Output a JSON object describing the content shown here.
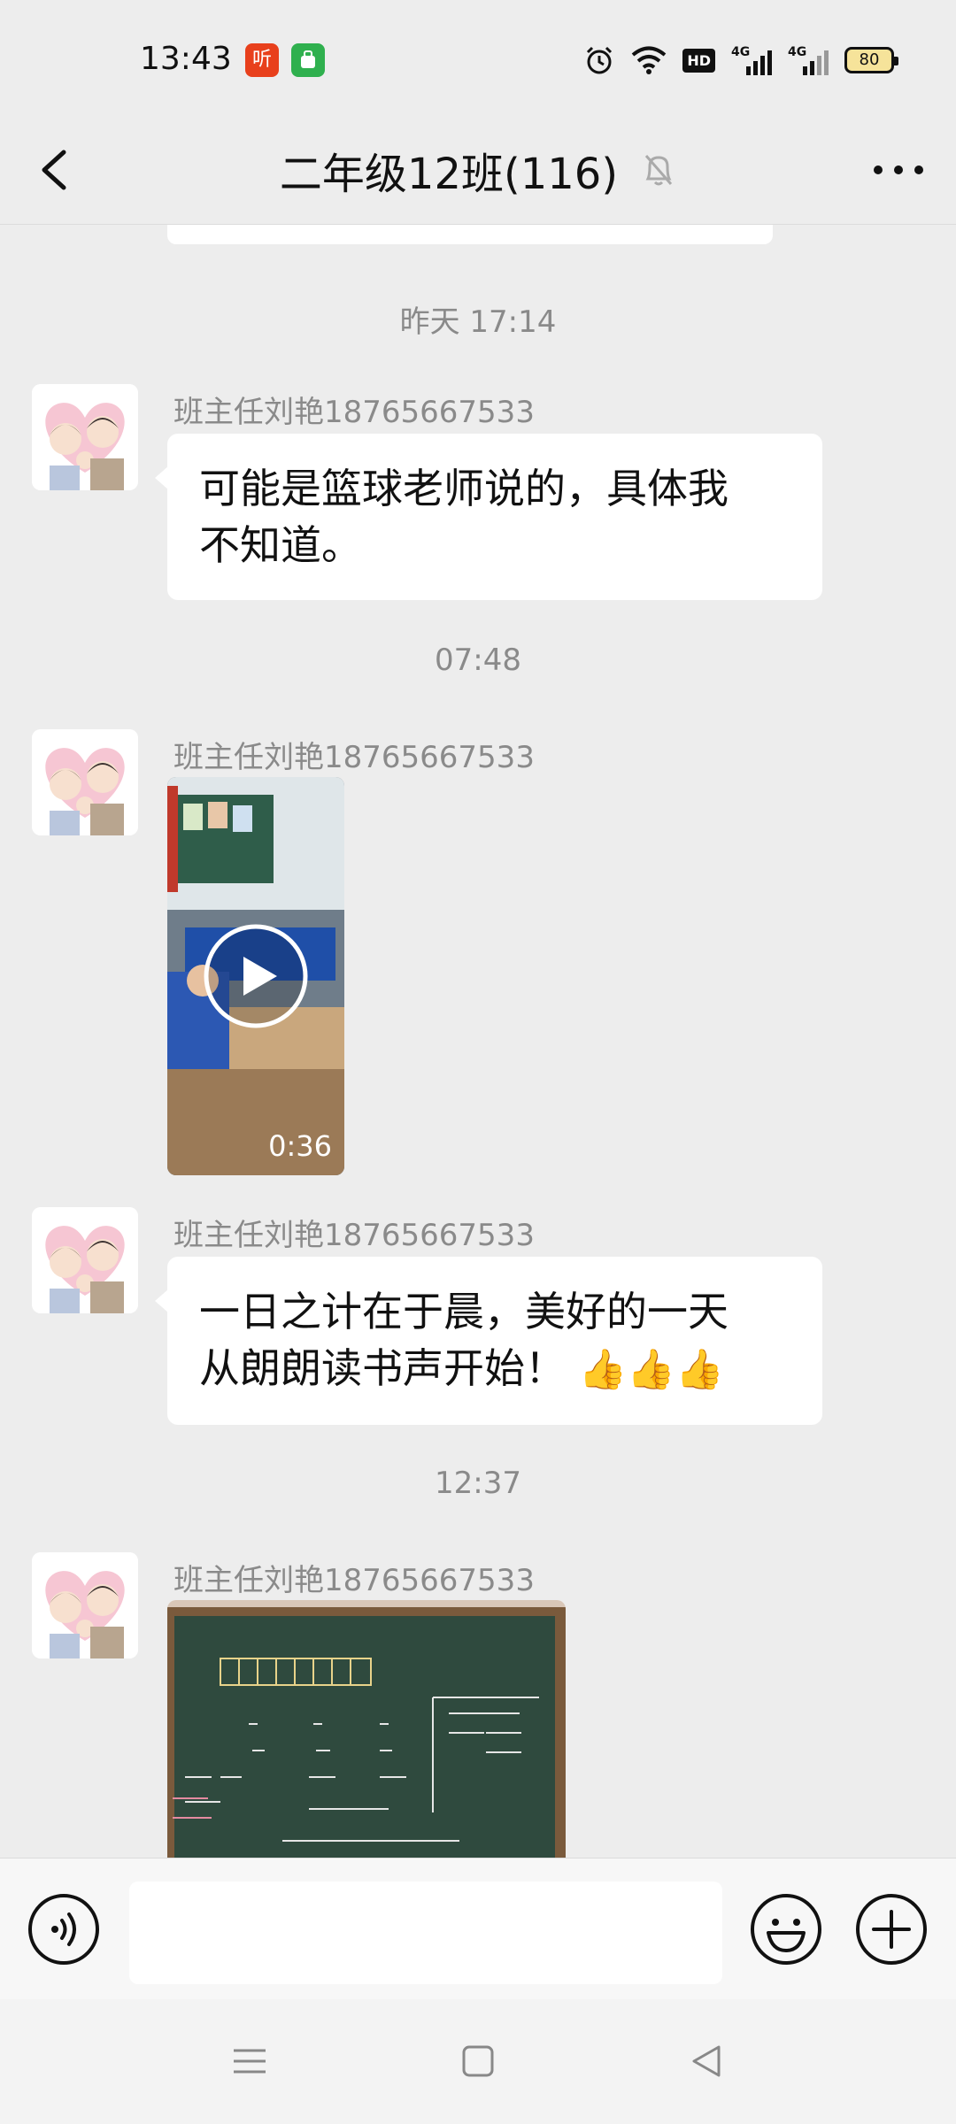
{
  "status_bar": {
    "time": "13:43",
    "app_icons": [
      {
        "name": "ting-app-icon",
        "glyph": "听",
        "color": "#e8401c"
      },
      {
        "name": "green-app-icon",
        "glyph": "",
        "color": "#2fb04e"
      }
    ],
    "network_1": "4G",
    "network_2": "4G",
    "hd_badge": "HD",
    "battery": "80"
  },
  "header": {
    "title": "二年级12班(116)"
  },
  "messages": [
    {
      "type": "timestamp",
      "text": "昨天 17:14"
    },
    {
      "type": "text",
      "sender": "班主任刘艳18765667533",
      "text_line1": "可能是篮球老师说的，具体我",
      "text_line2": "不知道。"
    },
    {
      "type": "timestamp",
      "text": "07:48"
    },
    {
      "type": "video",
      "sender": "班主任刘艳18765667533",
      "duration": "0:36"
    },
    {
      "type": "text",
      "sender": "班主任刘艳18765667533",
      "text_line1": "一日之计在于晨，美好的一天",
      "text_line2": "从朗朗读书声开始！"
    },
    {
      "type": "timestamp",
      "text": "12:37"
    },
    {
      "type": "image",
      "sender": "班主任刘艳18765667533"
    }
  ],
  "colors": {
    "background": "#ededed",
    "bubble": "#ffffff",
    "muted_text": "#8a8a8a"
  }
}
